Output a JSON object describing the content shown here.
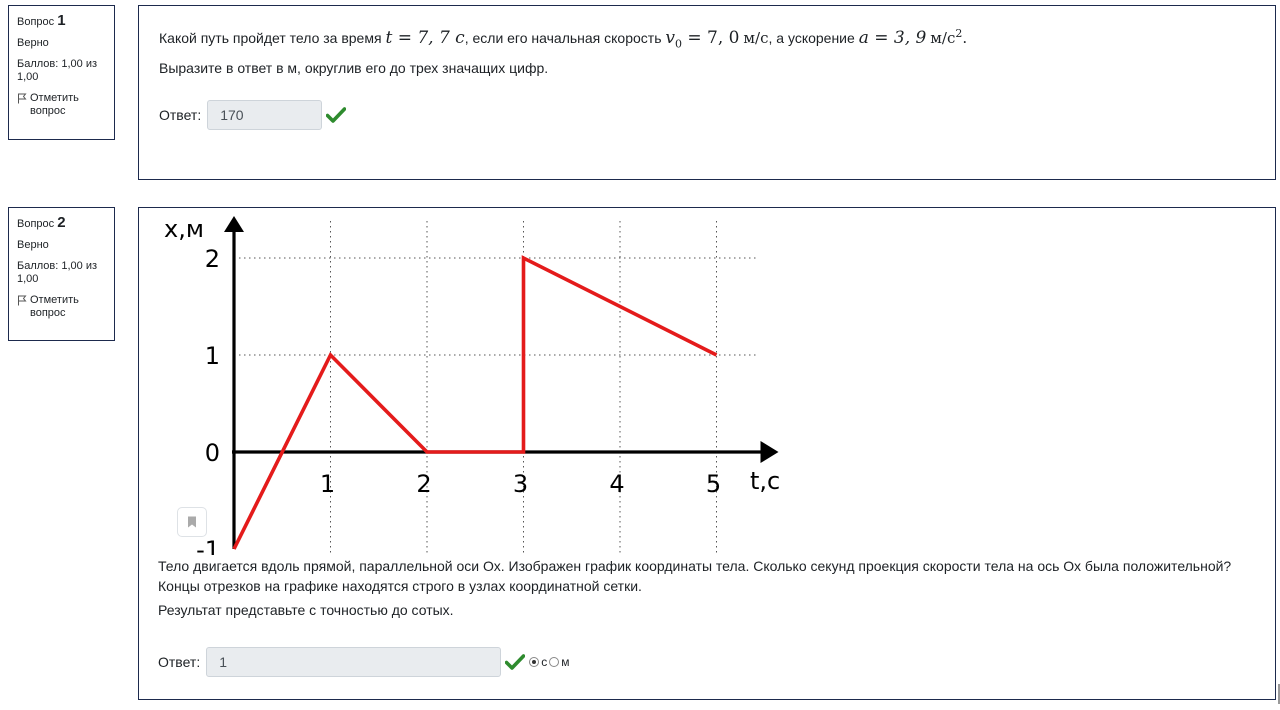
{
  "questions": [
    {
      "number_prefix": "Вопрос",
      "number": "1",
      "state": "Верно",
      "grade": "Баллов: 1,00 из 1,00",
      "flag_label": "Отметить вопрос",
      "text_part1": "Какой путь пройдет тело за время",
      "t_math": "t = 7, 7 c",
      "text_part2": ", если его начальная скорость",
      "v_math": "v",
      "v_sub": "0",
      "v_value": " = 7, 0",
      "v_unit": "м/с",
      "text_part3": ", а ускорение",
      "a_math": "a = 3, 9",
      "a_unit": "м/с",
      "a_sup": "2",
      "text_line2": "Выразите в ответ в м, округлив  его до трех значащих цифр.",
      "answer_label": "Ответ:",
      "answer_value": "170"
    },
    {
      "number_prefix": "Вопрос",
      "number": "2",
      "state": "Верно",
      "grade": "Баллов: 1,00 из 1,00",
      "flag_label": "Отметить вопрос",
      "text_line1": "Тело двигается вдоль прямой, параллельной оси Ох. Изображен график  координаты тела. Сколько секунд проекция скорости тела на ось Ох была положительной? Концы отрезков на графике находятся строго в узлах координатной сетки.",
      "text_line2": "Результат представьте с точностью до сотых.",
      "answer_label": "Ответ:",
      "answer_value": "1",
      "unit_options": [
        "с",
        "м"
      ],
      "unit_selected": "с"
    }
  ],
  "chart_data": {
    "type": "line",
    "xlabel": "t,с",
    "ylabel": "x,м",
    "x_ticks": [
      "1",
      "2",
      "3",
      "4",
      "5"
    ],
    "y_ticks": [
      "-1",
      "0",
      "1",
      "2"
    ],
    "xlim": [
      0,
      5
    ],
    "ylim": [
      -1,
      2
    ],
    "grid": "dotted",
    "series": [
      {
        "color": "#e41b1b",
        "points": [
          [
            0,
            -1
          ],
          [
            1,
            1
          ],
          [
            2,
            0
          ],
          [
            3,
            0
          ],
          [
            3,
            2
          ],
          [
            5,
            1
          ]
        ]
      }
    ]
  },
  "colors": {
    "accent": "#1d2a4d",
    "correct": "#2e8b2e",
    "graph_line": "#e41b1b"
  }
}
